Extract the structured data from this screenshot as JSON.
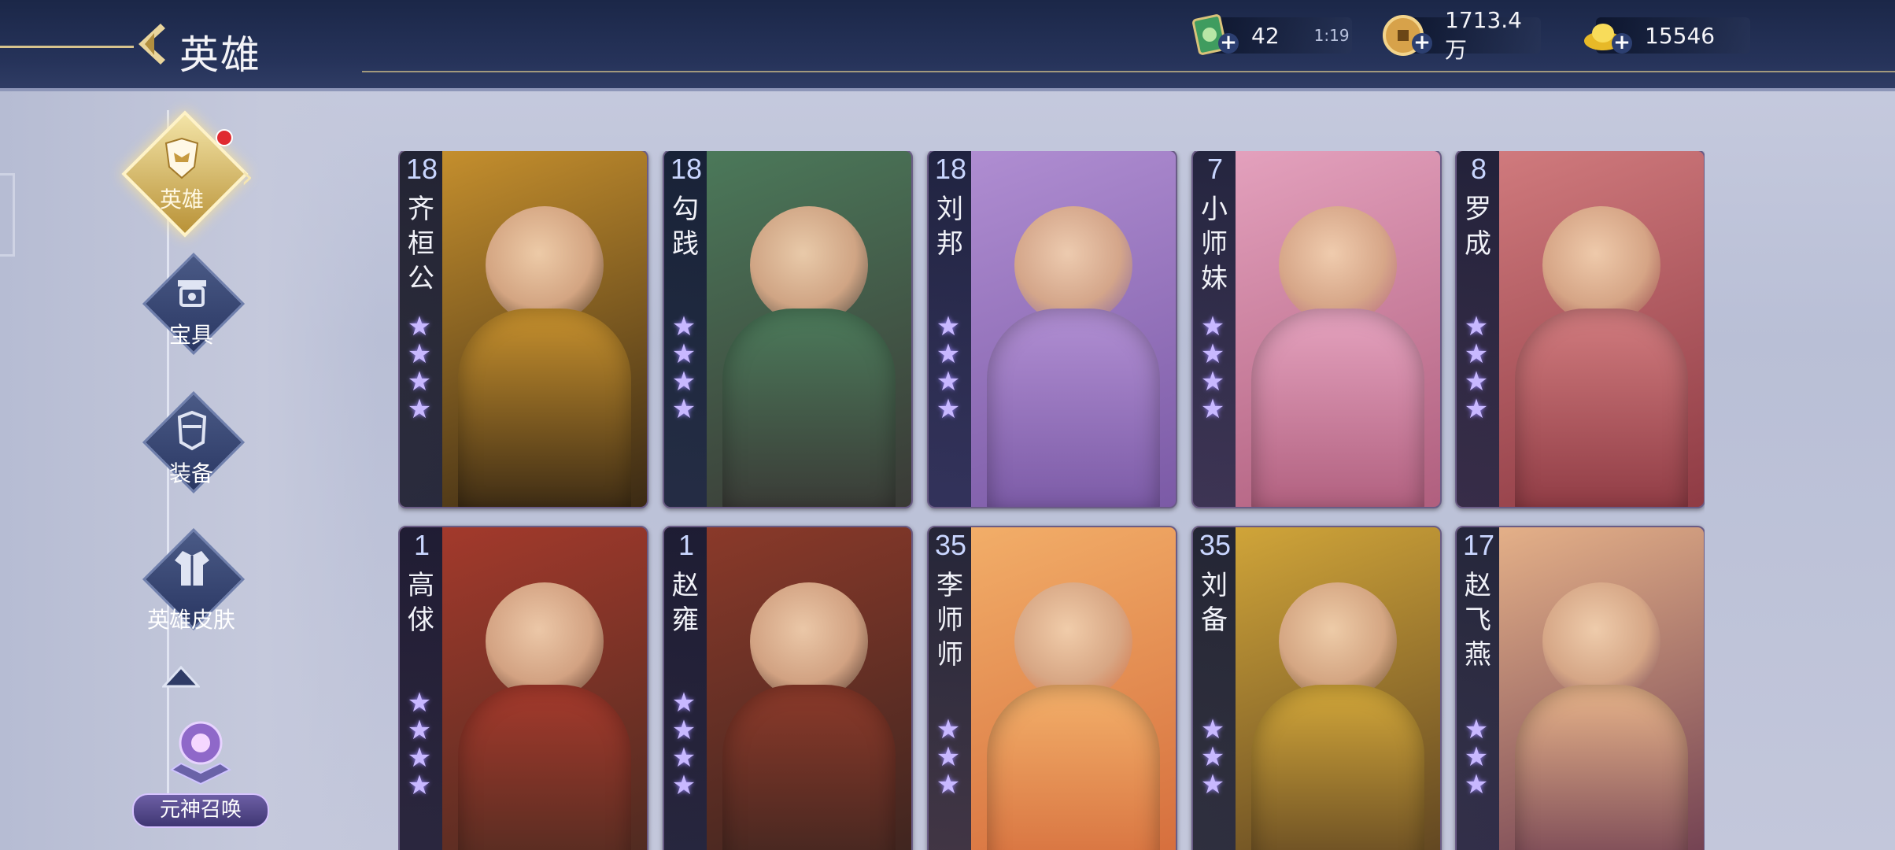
{
  "header": {
    "title": "英雄",
    "resources": [
      {
        "icon": "jade-token-icon",
        "value": "42",
        "timer": "1:19"
      },
      {
        "icon": "copper-coin-icon",
        "value": "1713.4万"
      },
      {
        "icon": "gold-ingot-icon",
        "value": "15546"
      }
    ]
  },
  "sidebar": {
    "items": [
      {
        "label": "英雄",
        "icon": "hero-helmet-icon",
        "active": true
      },
      {
        "label": "宝具",
        "icon": "treasure-icon"
      },
      {
        "label": "装备",
        "icon": "armor-icon"
      },
      {
        "label": "英雄皮肤",
        "icon": "skin-robe-icon"
      }
    ],
    "summon_label": "元神召唤"
  },
  "cards": [
    {
      "level": "18",
      "name": "齐桓公",
      "stars": 4,
      "colors": [
        "#3b2a14",
        "#c9922e"
      ]
    },
    {
      "level": "18",
      "name": "勾践",
      "stars": 4,
      "colors": [
        "#3a3a36",
        "#4c7b5b"
      ]
    },
    {
      "level": "18",
      "name": "刘邦",
      "stars": 4,
      "colors": [
        "#7b5aa6",
        "#b18fd3"
      ]
    },
    {
      "level": "7",
      "name": "小师妹",
      "stars": 4,
      "colors": [
        "#b05f7e",
        "#e5a3bf"
      ]
    },
    {
      "level": "8",
      "name": "罗成",
      "stars": 4,
      "colors": [
        "#8f3b44",
        "#d27c7f"
      ]
    },
    {
      "level": "1",
      "name": "高俅",
      "stars": 4,
      "colors": [
        "#4a2a20",
        "#a63a2c"
      ]
    },
    {
      "level": "1",
      "name": "赵雍",
      "stars": 4,
      "colors": [
        "#3a241f",
        "#8d3a2a"
      ]
    },
    {
      "level": "35",
      "name": "李师师",
      "stars": 3,
      "colors": [
        "#d46a3a",
        "#f3b06a"
      ]
    },
    {
      "level": "35",
      "name": "刘备",
      "stars": 3,
      "colors": [
        "#5a4020",
        "#d4a83a"
      ]
    },
    {
      "level": "17",
      "name": "赵飞燕",
      "stars": 3,
      "colors": [
        "#6b3a4f",
        "#e8b48a"
      ]
    }
  ]
}
